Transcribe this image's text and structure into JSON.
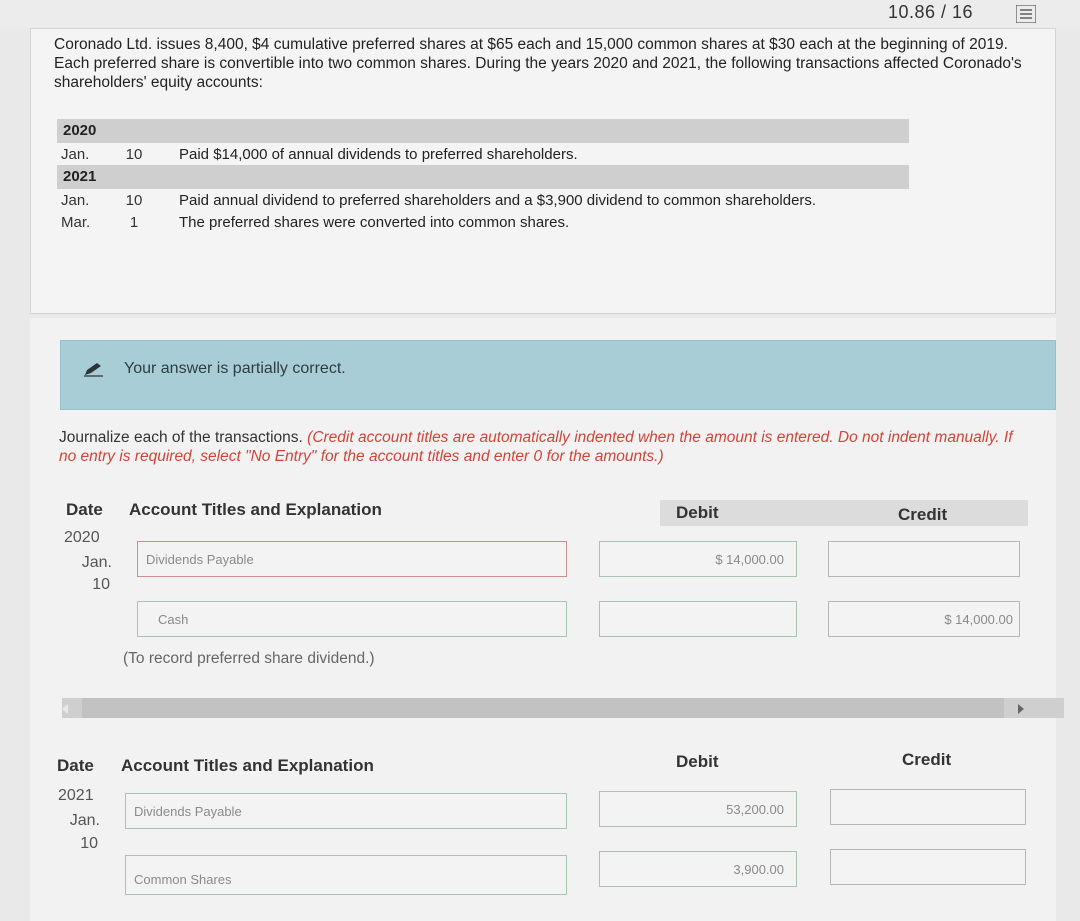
{
  "header": {
    "score": "10.86 / 16",
    "menu_icon": "list-icon"
  },
  "problem": {
    "text": "Coronado Ltd. issues 8,400, $4 cumulative preferred shares at $65 each and 15,000 common shares at $30 each at the beginning of 2019. Each preferred share is convertible into two common shares. During the years 2020 and 2021, the following transactions affected Coronado's shareholders' equity accounts:",
    "years": [
      {
        "year": "2020",
        "rows": [
          {
            "month": "Jan.",
            "day": "10",
            "desc": "Paid $14,000 of annual dividends to preferred shareholders."
          }
        ]
      },
      {
        "year": "2021",
        "rows": [
          {
            "month": "Jan.",
            "day": "10",
            "desc": "Paid annual dividend to preferred shareholders and a $3,900 dividend to common shareholders."
          },
          {
            "month": "Mar.",
            "day": "1",
            "desc": "The preferred shares were converted into common shares."
          }
        ]
      }
    ]
  },
  "feedback": {
    "text": "Your answer is partially correct.",
    "icon": "pencil-icon",
    "color": "#a9cdd6"
  },
  "instructions": {
    "main": "Journalize each of the transactions. ",
    "red": "(Credit account titles are automatically indented when the amount is entered. Do not indent manually. If no entry is required, select \"No Entry\" for the account titles and enter 0 for the amounts.)"
  },
  "columns": {
    "date": "Date",
    "account": "Account Titles and Explanation",
    "debit": "Debit",
    "credit": "Credit"
  },
  "entry1": {
    "year": "2020",
    "month": "Jan.",
    "day": "10",
    "line1": {
      "account": "Dividends Payable",
      "debit": "$ 14,000.00",
      "credit": ""
    },
    "line2": {
      "account": "Cash",
      "debit": "",
      "credit": "$ 14,000.00"
    },
    "note": "(To record preferred share dividend.)"
  },
  "entry2": {
    "year": "2021",
    "month": "Jan.",
    "day": "10",
    "line1": {
      "account": "Dividends Payable",
      "debit": "53,200.00",
      "credit": ""
    },
    "line2": {
      "account": "Common Shares",
      "debit": "3,900.00",
      "credit": ""
    }
  }
}
